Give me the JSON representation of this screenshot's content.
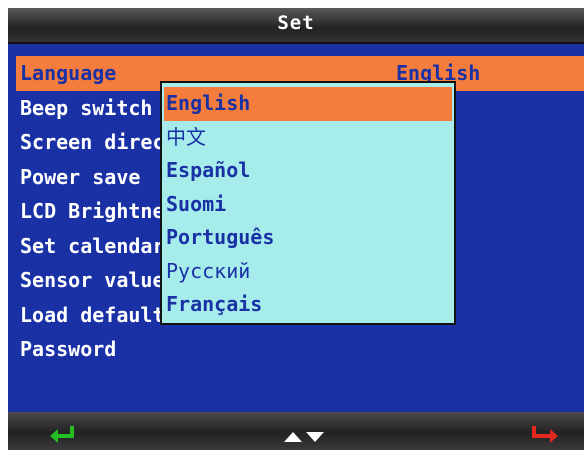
{
  "header": {
    "title": "Set"
  },
  "menu": {
    "items": [
      {
        "label": "Language",
        "value": "English",
        "selected": true
      },
      {
        "label": "Beep switch"
      },
      {
        "label": "Screen direction"
      },
      {
        "label": "Power save"
      },
      {
        "label": "LCD Brightness"
      },
      {
        "label": "Set calendar"
      },
      {
        "label": "Sensor value"
      },
      {
        "label": "Load default"
      },
      {
        "label": "Password"
      }
    ]
  },
  "language_dropdown": {
    "selected": "English",
    "options": [
      "English",
      "中文",
      "Español",
      "Suomi",
      "Português",
      "Русский",
      "Français"
    ]
  },
  "footer": {
    "icons": [
      "enter-icon",
      "up-down-icon",
      "back-icon"
    ]
  },
  "colors": {
    "background": "#1a31a6",
    "highlight": "#f47c3c",
    "dropdown_bg": "#a6eceb",
    "enter_icon": "#22c022",
    "back_icon": "#e0281e"
  }
}
